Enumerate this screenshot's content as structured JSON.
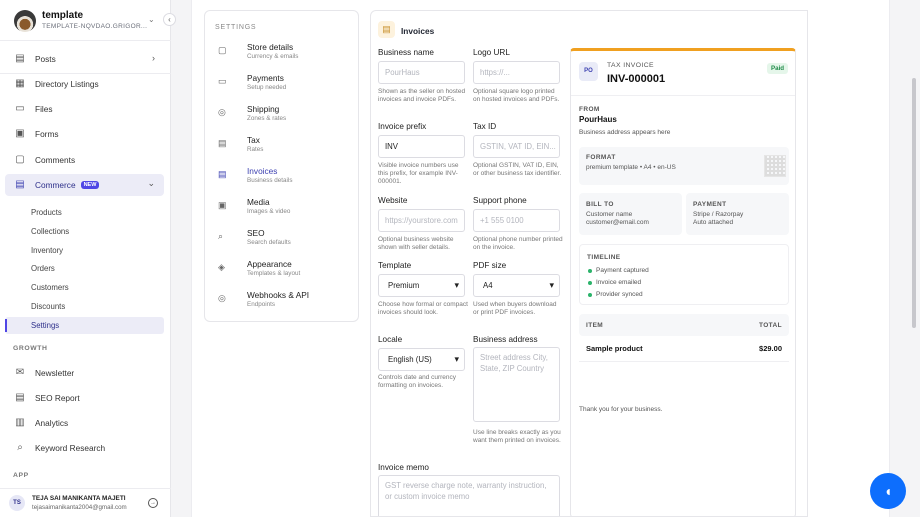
{
  "brand": {
    "name": "template",
    "subtitle": "TEMPLATE-NQVDAO.GRIGOR..."
  },
  "sidebar": {
    "items": [
      {
        "label": "Posts",
        "icon": "document-icon"
      },
      {
        "label": "Directory Listings",
        "icon": "directory-icon"
      },
      {
        "label": "Files",
        "icon": "folder-icon"
      },
      {
        "label": "Forms",
        "icon": "clipboard-icon"
      },
      {
        "label": "Comments",
        "icon": "comment-icon"
      },
      {
        "label": "Commerce",
        "icon": "cart-icon",
        "badge": "NEW"
      }
    ],
    "commerce_sub": [
      "Products",
      "Collections",
      "Inventory",
      "Orders",
      "Customers",
      "Discounts",
      "Settings"
    ],
    "growth_label": "GROWTH",
    "growth": [
      {
        "label": "Newsletter",
        "icon": "mail-icon"
      },
      {
        "label": "SEO Report",
        "icon": "report-icon"
      },
      {
        "label": "Analytics",
        "icon": "chart-icon"
      },
      {
        "label": "Keyword Research",
        "icon": "search-icon"
      }
    ],
    "app_label": "APP"
  },
  "user": {
    "initials": "TS",
    "name": "TEJA SAI MANIKANTA MAJETI",
    "email": "tejasaimanikanta2004@gmail.com"
  },
  "settings": {
    "title": "SETTINGS",
    "items": [
      {
        "title": "Store details",
        "sub": "Currency & emails"
      },
      {
        "title": "Payments",
        "sub": "Setup needed"
      },
      {
        "title": "Shipping",
        "sub": "Zones & rates"
      },
      {
        "title": "Tax",
        "sub": "Rates"
      },
      {
        "title": "Invoices",
        "sub": "Business details"
      },
      {
        "title": "Media",
        "sub": "Images & video"
      },
      {
        "title": "SEO",
        "sub": "Search defaults"
      },
      {
        "title": "Appearance",
        "sub": "Templates & layout"
      },
      {
        "title": "Webhooks & API",
        "sub": "Endpoints"
      }
    ]
  },
  "form": {
    "title": "Invoices",
    "business_name": {
      "label": "Business name",
      "placeholder": "PourHaus",
      "help": "Shown as the seller on hosted invoices and invoice PDFs."
    },
    "logo_url": {
      "label": "Logo URL",
      "placeholder": "https://...",
      "help": "Optional square logo printed on hosted invoices and PDFs."
    },
    "invoice_prefix": {
      "label": "Invoice prefix",
      "value": "INV",
      "help": "Visible invoice numbers use this prefix, for example INV-000001."
    },
    "tax_id": {
      "label": "Tax ID",
      "placeholder": "GSTIN, VAT ID, EIN...",
      "help": "Optional GSTIN, VAT ID, EIN, or other business tax identifier."
    },
    "website": {
      "label": "Website",
      "placeholder": "https://yourstore.com",
      "help": "Optional business website shown with seller details."
    },
    "support_phone": {
      "label": "Support phone",
      "placeholder": "+1 555 0100",
      "help": "Optional phone number printed on the invoice."
    },
    "template": {
      "label": "Template",
      "value": "Premium",
      "help": "Choose how formal or compact invoices should look."
    },
    "pdf_size": {
      "label": "PDF size",
      "value": "A4",
      "help": "Used when buyers download or print PDF invoices."
    },
    "locale": {
      "label": "Locale",
      "value": "English (US)",
      "help": "Controls date and currency formatting on invoices."
    },
    "business_address": {
      "label": "Business address",
      "placeholder": "Street address City, State, ZIP Country",
      "help": "Use line breaks exactly as you want them printed on invoices."
    },
    "invoice_memo": {
      "label": "Invoice memo",
      "placeholder": "GST reverse charge note, warranty instruction, or custom invoice memo"
    }
  },
  "preview": {
    "logo_initials": "PO",
    "doc_type": "TAX INVOICE",
    "number": "INV-000001",
    "status": "Paid",
    "from_label": "FROM",
    "from_name": "PourHaus",
    "from_address": "Business address appears here",
    "format_label": "FORMAT",
    "format_value": "premium template • A4 • en-US",
    "bill_to_label": "BILL TO",
    "bill_to_name": "Customer name",
    "bill_to_email": "customer@email.com",
    "payment_label": "PAYMENT",
    "payment_method": "Stripe / Razorpay",
    "payment_note": "Auto attached",
    "timeline_label": "TIMELINE",
    "timeline": [
      "Payment captured",
      "Invoice emailed",
      "Provider synced"
    ],
    "item_label": "ITEM",
    "total_label": "TOTAL",
    "item_name": "Sample product",
    "item_total": "$29.00",
    "thanks": "Thank you for your business."
  }
}
